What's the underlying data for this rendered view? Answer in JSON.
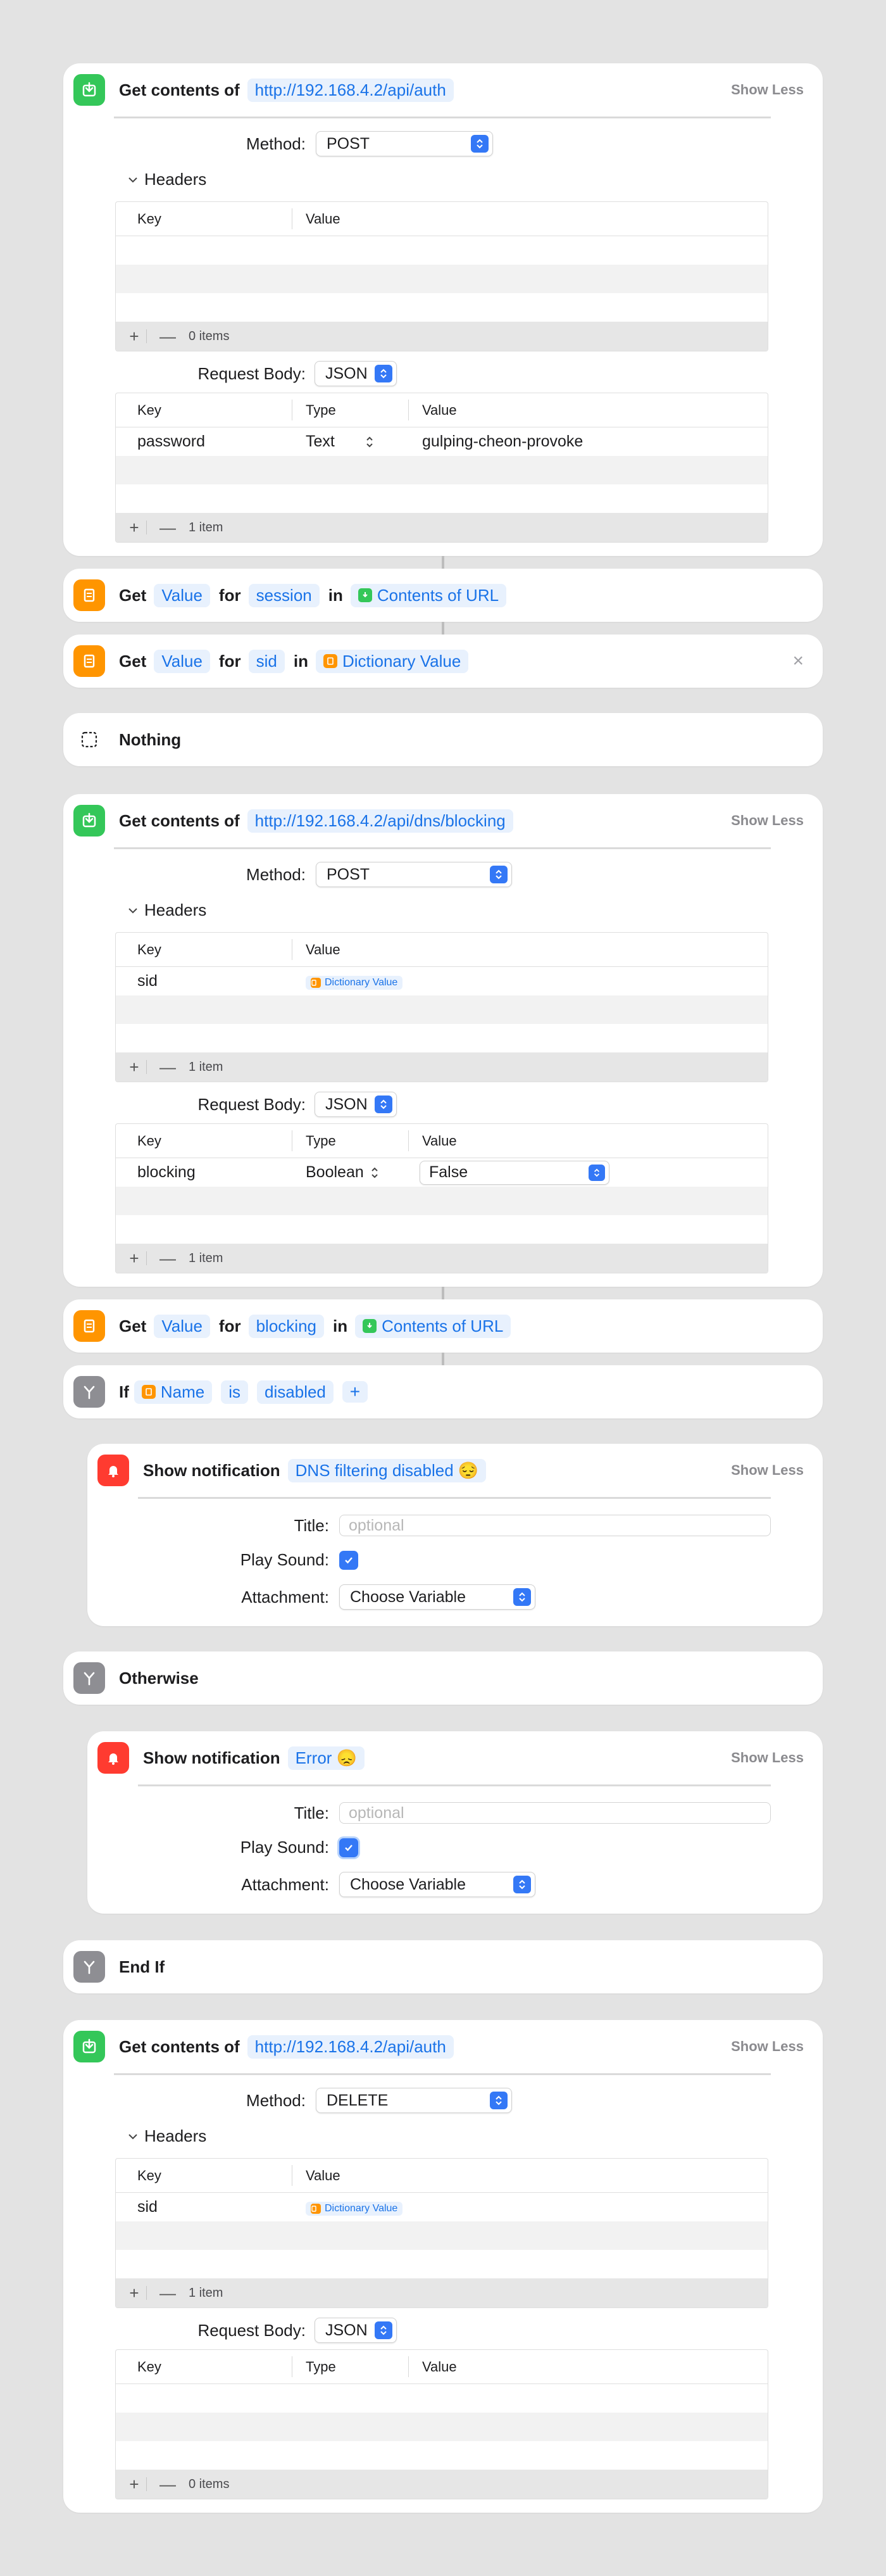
{
  "colors": {
    "accent": "#3478f6",
    "green": "#34c759",
    "orange": "#ff9500",
    "red": "#ff3b30",
    "gray": "#8e8e93"
  },
  "labels": {
    "show_less": "Show Less",
    "method": "Method:",
    "headers": "Headers",
    "request_body": "Request Body:",
    "col_key": "Key",
    "col_value": "Value",
    "col_type": "Type",
    "title": "Title:",
    "play_sound": "Play Sound:",
    "attachment": "Attachment:",
    "plus": "+",
    "minus": "—"
  },
  "actions": {
    "url1": {
      "prefix": "Get contents of",
      "url": "http://192.168.4.2/api/auth",
      "method": "POST",
      "headers_count": "0 items",
      "body_type": "JSON",
      "body_rows": [
        {
          "key": "password",
          "type": "Text",
          "value": "gulping-cheon-provoke"
        }
      ],
      "body_count": "1 item"
    },
    "get1": {
      "get": "Get",
      "what": "Value",
      "for": "for",
      "key": "session",
      "in": "in",
      "source": "Contents of URL"
    },
    "get2": {
      "get": "Get",
      "what": "Value",
      "for": "for",
      "key": "sid",
      "in": "in",
      "source": "Dictionary Value",
      "close": "×"
    },
    "nothing": {
      "label": "Nothing"
    },
    "url2": {
      "prefix": "Get contents of",
      "url": "http://192.168.4.2/api/dns/blocking",
      "method": "POST",
      "header_rows": [
        {
          "key": "sid",
          "value": "Dictionary Value"
        }
      ],
      "headers_count": "1 item",
      "body_type": "JSON",
      "body_rows": [
        {
          "key": "blocking",
          "type": "Boolean",
          "value": "False"
        }
      ],
      "body_count": "1 item"
    },
    "get3": {
      "get": "Get",
      "what": "Value",
      "for": "for",
      "key": "blocking",
      "in": "in",
      "source": "Contents of URL"
    },
    "if": {
      "label": "If",
      "var": "Name",
      "op": "is",
      "val": "disabled",
      "add": "+"
    },
    "notif1": {
      "label": "Show notification",
      "message": "DNS filtering disabled 😔",
      "title_placeholder": "optional",
      "attachment": "Choose Variable"
    },
    "otherwise": {
      "label": "Otherwise"
    },
    "notif2": {
      "label": "Show notification",
      "message": "Error 😞",
      "title_placeholder": "optional",
      "attachment": "Choose Variable"
    },
    "endif": {
      "label": "End If"
    },
    "url3": {
      "prefix": "Get contents of",
      "url": "http://192.168.4.2/api/auth",
      "method": "DELETE",
      "header_rows": [
        {
          "key": "sid",
          "value": "Dictionary Value"
        }
      ],
      "headers_count": "1 item",
      "body_type": "JSON",
      "body_count": "0 items"
    }
  }
}
